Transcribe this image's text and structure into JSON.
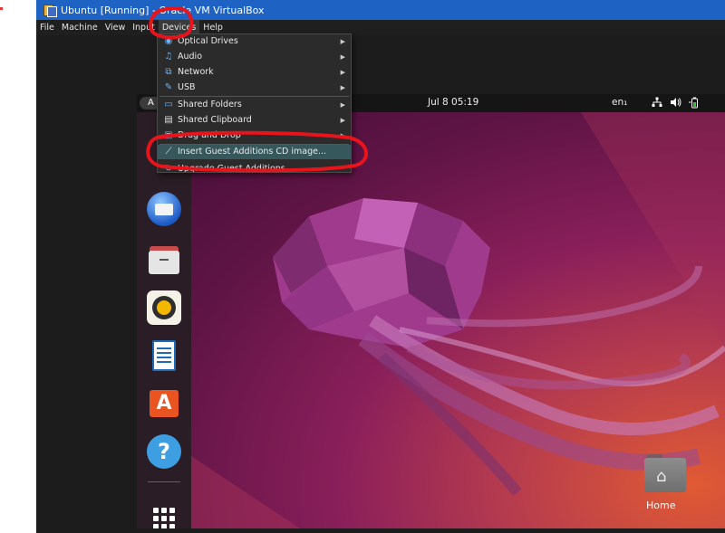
{
  "window": {
    "title": "Ubuntu [Running] - Oracle VM VirtualBox"
  },
  "menubar": {
    "items": [
      "File",
      "Machine",
      "View",
      "Input",
      "Devices",
      "Help"
    ],
    "active": "Devices"
  },
  "devices_menu": {
    "items": [
      {
        "label": "Optical Drives",
        "icon": "optical-drive-icon",
        "submenu": true
      },
      {
        "label": "Audio",
        "icon": "audio-icon",
        "submenu": true
      },
      {
        "label": "Network",
        "icon": "network-icon",
        "submenu": true
      },
      {
        "label": "USB",
        "icon": "usb-icon",
        "submenu": true
      },
      {
        "label": "Shared Folders",
        "icon": "shared-folder-icon",
        "submenu": true
      },
      {
        "label": "Shared Clipboard",
        "icon": "clipboard-icon",
        "submenu": true
      },
      {
        "label": "Drag and Drop",
        "icon": "drag-drop-icon",
        "submenu": true
      },
      {
        "label": "Insert Guest Additions CD image...",
        "icon": "insert-cd-icon",
        "submenu": false,
        "highlighted": true
      },
      {
        "label": "Upgrade Guest Additions",
        "icon": "upgrade-icon",
        "submenu": false
      }
    ]
  },
  "guest": {
    "topbar": {
      "activities": "A",
      "clock": "Jul 8  05:19",
      "language": "en₁",
      "tray_icons": [
        "network-wired-icon",
        "volume-icon",
        "battery-icon"
      ]
    },
    "dock": {
      "apps": [
        "thunderbird",
        "files",
        "rhythmbox",
        "libreoffice-writer",
        "app-center",
        "help"
      ],
      "help_glyph": "?"
    },
    "desktop": {
      "home_label": "Home"
    }
  },
  "colors": {
    "titlebar": "#1e63c4",
    "highlight": "#36575b",
    "annotation": "#e8141c",
    "ubuntu_orange": "#e95420"
  }
}
